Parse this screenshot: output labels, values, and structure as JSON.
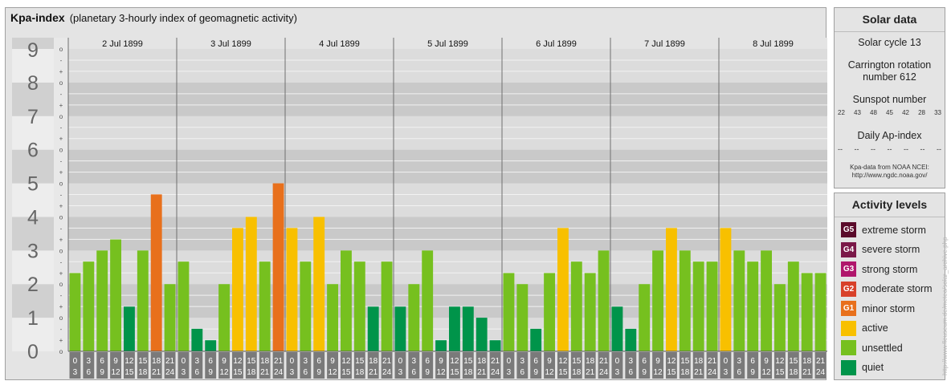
{
  "header": {
    "title": "Kpa-index",
    "subtitle": "(planetary 3-hourly index of geomagnetic activity)"
  },
  "chart_data": {
    "type": "bar",
    "ylim": [
      0,
      9
    ],
    "y_ticks": [
      "0",
      "1",
      "2",
      "3",
      "4",
      "5",
      "6",
      "7",
      "8",
      "9"
    ],
    "sub_ticks": [
      "o",
      "+",
      "-"
    ],
    "days": [
      "2 Jul 1899",
      "3 Jul 1899",
      "4 Jul 1899",
      "5 Jul 1899",
      "6 Jul 1899",
      "7 Jul 1899",
      "8 Jul 1899"
    ],
    "interval_start": [
      "0",
      "3",
      "6",
      "9",
      "12",
      "15",
      "18",
      "21"
    ],
    "interval_end": [
      "3",
      "6",
      "9",
      "12",
      "15",
      "18",
      "21",
      "24"
    ],
    "values": [
      [
        2.33,
        2.67,
        3.0,
        3.33,
        1.33,
        3.0,
        4.67,
        2.0
      ],
      [
        2.67,
        0.67,
        0.33,
        2.0,
        3.67,
        4.0,
        2.67,
        5.0
      ],
      [
        3.67,
        2.67,
        4.0,
        2.0,
        3.0,
        2.67,
        1.33,
        2.67
      ],
      [
        1.33,
        2.0,
        3.0,
        0.33,
        1.33,
        1.33,
        1.0,
        0.33
      ],
      [
        2.33,
        2.0,
        0.67,
        2.33,
        3.67,
        2.67,
        2.33,
        3.0
      ],
      [
        1.33,
        0.67,
        2.0,
        3.0,
        3.67,
        3.0,
        2.67,
        2.67
      ],
      [
        3.67,
        3.0,
        2.67,
        3.0,
        2.0,
        2.67,
        2.33,
        2.33
      ]
    ]
  },
  "solar": {
    "title": "Solar data",
    "cycle": "Solar cycle 13",
    "rotation_line1": "Carrington rotation",
    "rotation_line2": "number 612",
    "sunspot_label": "Sunspot number",
    "sunspots": [
      "22",
      "43",
      "48",
      "45",
      "42",
      "28",
      "33"
    ],
    "ap_label": "Daily Ap-index",
    "ap_values": [
      "--",
      "--",
      "--",
      "--",
      "--",
      "--",
      "--"
    ],
    "credit1": "Kpa-data from NOAA NCEI:",
    "credit2": "http://www.ngdc.noaa.gov/"
  },
  "activity": {
    "title": "Activity levels",
    "levels": [
      {
        "code": "G5",
        "label": "extreme storm",
        "color": "#5a0a2a"
      },
      {
        "code": "G4",
        "label": "severe storm",
        "color": "#7a1848"
      },
      {
        "code": "G3",
        "label": "strong storm",
        "color": "#b0166c"
      },
      {
        "code": "G2",
        "label": "moderate storm",
        "color": "#d8412a"
      },
      {
        "code": "G1",
        "label": "minor storm",
        "color": "#e8701c"
      },
      {
        "code": "",
        "label": "active",
        "color": "#f8c000"
      },
      {
        "code": "",
        "label": "unsettled",
        "color": "#76c01f"
      },
      {
        "code": "",
        "label": "quiet",
        "color": "#00944a"
      }
    ]
  },
  "watermark": "http://www.fleuseum.de/meteo/solar_archive.php"
}
